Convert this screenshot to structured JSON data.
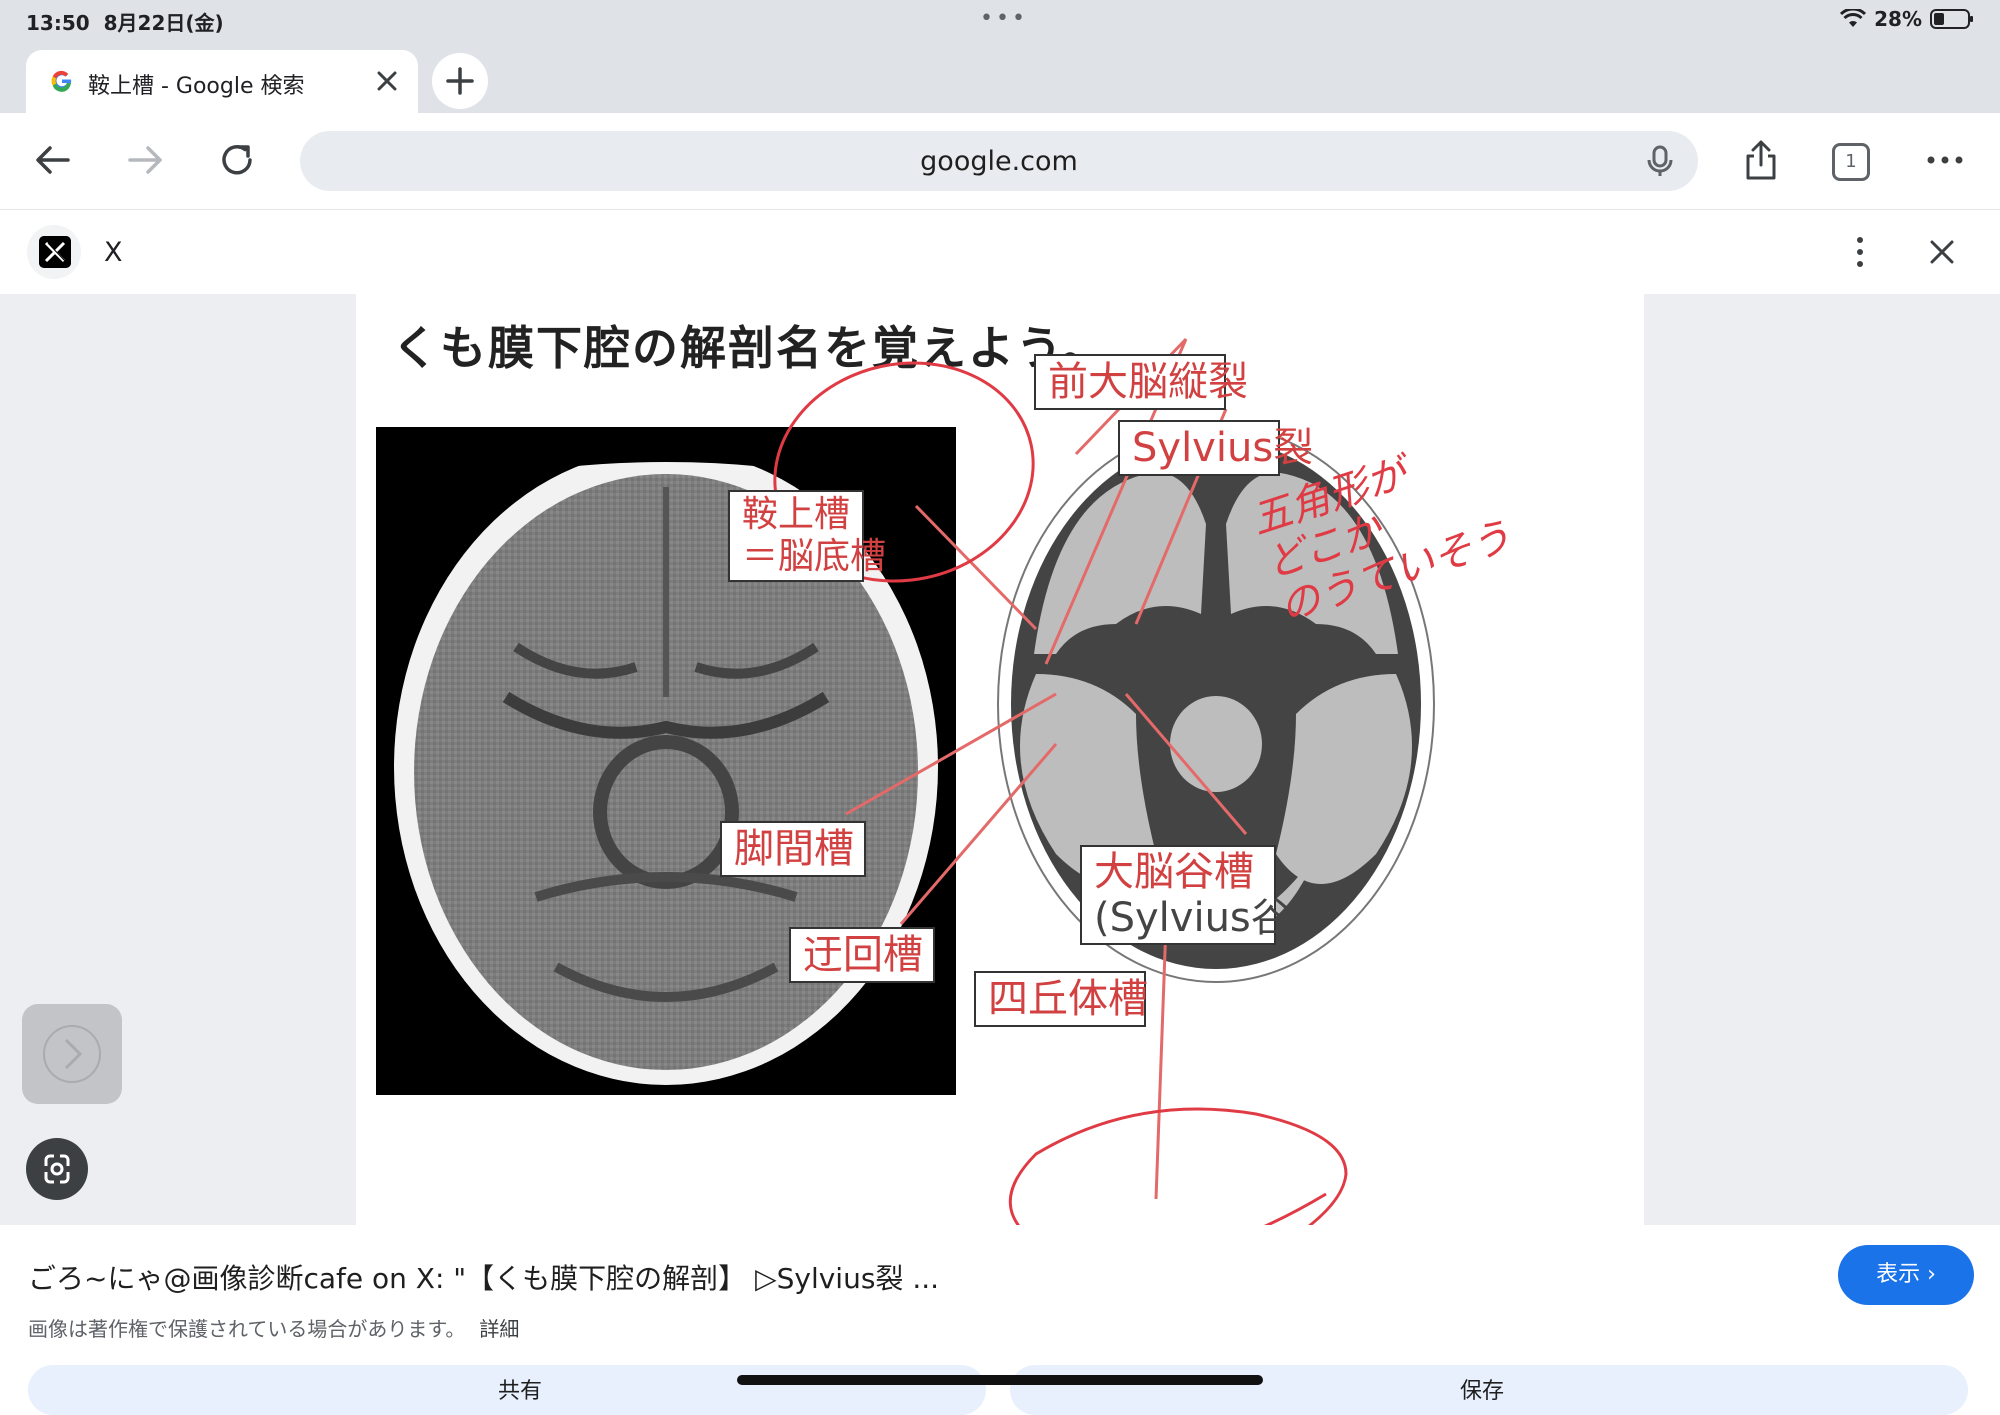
{
  "status": {
    "time": "13:50",
    "date": "8月22日(金)",
    "dots": "•••",
    "battery": "28%"
  },
  "tab": {
    "title": "鞍上槽 - Google 検索"
  },
  "omnibox": {
    "url": "google.com",
    "tab_count": "1"
  },
  "source": {
    "name": "X"
  },
  "figure": {
    "title": "くも膜下腔の解剖名を覚えよう。",
    "labels": {
      "interhemispheric": "前大脳縦裂",
      "sylvian_fissure": "Sylvius裂",
      "suprasellar_line1": "鞍上槽",
      "suprasellar_line2": "＝脳底槽",
      "interpeduncular": "脚間槽",
      "sylvian_cistern_line1": "大脳谷槽",
      "sylvian_cistern_line2": "(Sylvius谷)",
      "ambient": "迂回槽",
      "quadrigeminal": "四丘体槽"
    },
    "note_lines": [
      "五角形が",
      "どこか",
      "のうていそう"
    ]
  },
  "caption": {
    "title": "ごろ~にゃ@画像診断cafe on X: \"【くも膜下腔の解剖】 ▷Sylvius裂 ...",
    "copyright": "画像は著作権で保護されている場合があります。",
    "details": "詳細",
    "view_button": "表示 ›",
    "share": "共有",
    "save": "保存"
  },
  "colors": {
    "accent": "#1a73e8",
    "label_red": "#d24141",
    "annotation_red": "#e03b45"
  }
}
